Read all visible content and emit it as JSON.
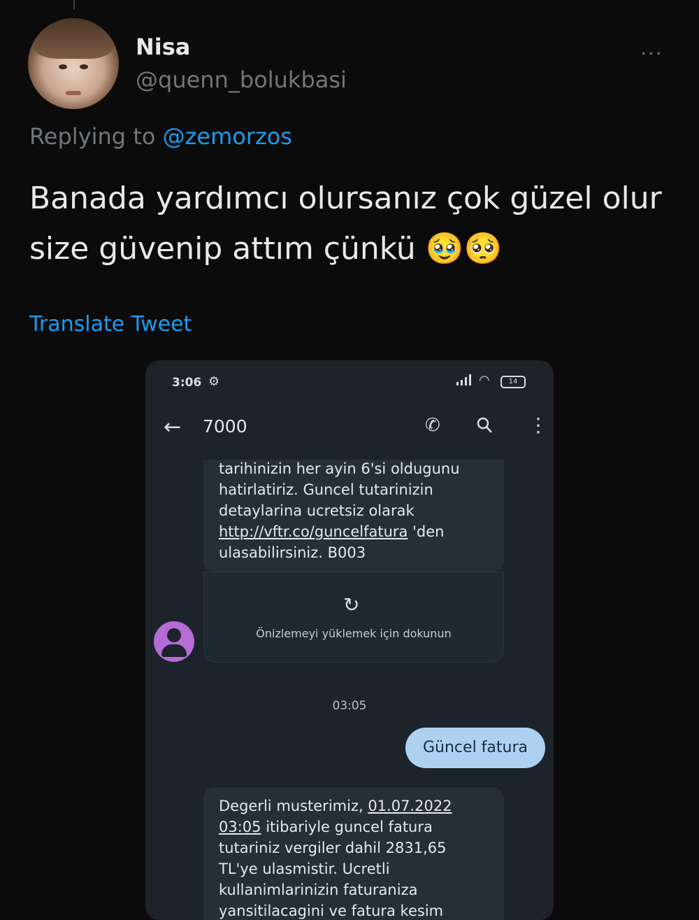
{
  "tweet": {
    "display_name": "Nisa",
    "handle": "@quenn_bolukbasi",
    "more_label": "···",
    "replying_prefix": "Replying to",
    "replying_to": "@zemorzos",
    "text": "Banada yardımcı olursanız çok güzel olur size güvenip attım çünkü 🥹🥺",
    "translate_label": "Translate Tweet"
  },
  "screenshot": {
    "status_bar": {
      "time": "3:06",
      "battery": "14"
    },
    "header": {
      "contact": "7000"
    },
    "messages": {
      "top_lines": [
        "tarihinizin her ayin 6'si oldugunu",
        "hatirlatiriz. Guncel tutarinizin",
        "detaylarina ucretsiz olarak",
        "http://vftr.co/guncelfatura",
        " 'den",
        "ulasabilirsiniz. B003"
      ],
      "preview_label": "Önizlemeyi yüklemek için dokunun",
      "timestamp": "03:05",
      "outgoing": "Güncel fatura",
      "bottom_lines": [
        "Degerli musterimiz, ",
        "01.07.2022",
        "03:05",
        " itibariyle guncel fatura",
        "tutariniz vergiler dahil 2831,65",
        "TL'ye ulasmistir. Ucretli",
        "kullanimlarinizin faturaniza",
        "yansitilacagini ve fatura kesim"
      ]
    }
  },
  "colors": {
    "accent": "#1d9bf0",
    "muted": "#71767b",
    "outgoing_bubble": "#aed1f2",
    "sender_avatar": "#b66cd6"
  }
}
